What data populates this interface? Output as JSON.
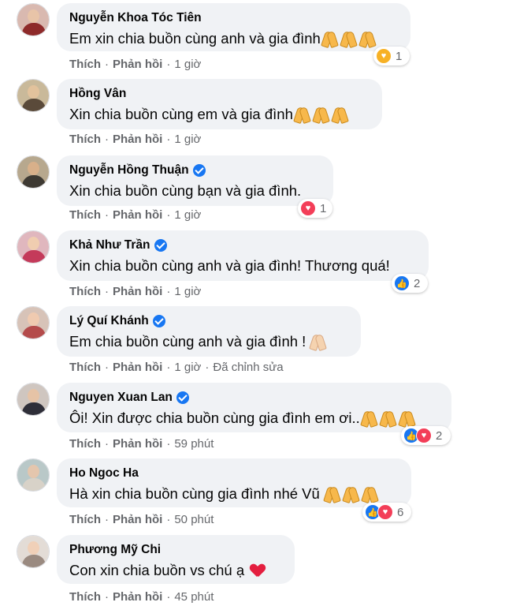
{
  "action_labels": {
    "like": "Thích",
    "reply": "Phản hồi",
    "separator": "·"
  },
  "comments": [
    {
      "name": "Nguyễn Khoa Tóc Tiên",
      "verified": false,
      "text": "Em xin chia buồn cùng anh và gia đình",
      "emoji": "🙏🙏🙏",
      "time": "1 giờ",
      "edited": "",
      "reactions": [
        "care-icon"
      ],
      "reaction_count": "1"
    },
    {
      "name": "Hồng Vân",
      "verified": false,
      "text": "Xin chia buồn cùng em và gia đình",
      "emoji": "🙏🙏🙏",
      "time": "1 giờ",
      "edited": "",
      "reactions": [],
      "reaction_count": ""
    },
    {
      "name": "Nguyễn Hồng Thuận",
      "verified": true,
      "text": "Xin chia buồn cùng bạn và gia đình.",
      "emoji": "",
      "time": "1 giờ",
      "edited": "",
      "reactions": [
        "love-icon"
      ],
      "reaction_count": "1"
    },
    {
      "name": "Khả Như Trần",
      "verified": true,
      "text": "Xin chia buồn cùng anh và gia đình! Thương quá!",
      "emoji": "",
      "time": "1 giờ",
      "edited": "",
      "reactions": [
        "like-icon"
      ],
      "reaction_count": "2"
    },
    {
      "name": "Lý Quí Khánh",
      "verified": true,
      "text": "Em chia buồn cùng anh và gia đình !",
      "emoji": "🙏",
      "time": "1 giờ",
      "edited": "Đã chỉnh sửa",
      "reactions": [],
      "reaction_count": ""
    },
    {
      "name": "Nguyen Xuan Lan",
      "verified": true,
      "text": "Ôi! Xin được chia buồn cùng gia đình em ơi..",
      "emoji": "🙏🙏🙏",
      "time": "59 phút",
      "edited": "",
      "reactions": [
        "like-icon",
        "love-icon"
      ],
      "reaction_count": "2"
    },
    {
      "name": "Ho Ngoc Ha",
      "verified": false,
      "text": "Hà xin chia buồn cùng gia đình nhé Vũ",
      "emoji": "🙏🙏🙏",
      "time": "50 phút",
      "edited": "",
      "reactions": [
        "like-icon",
        "love-icon"
      ],
      "reaction_count": "6"
    },
    {
      "name": "Phương Mỹ Chi",
      "verified": false,
      "text": "Con xin chia buồn vs chú ạ",
      "emoji": "❤️",
      "time": "45 phút",
      "edited": "",
      "reactions": [],
      "reaction_count": ""
    }
  ],
  "colors": {
    "bubble": "#f0f2f5",
    "meta_text": "#65676b",
    "like_blue": "#1877f2",
    "love_red": "#f33e58"
  }
}
